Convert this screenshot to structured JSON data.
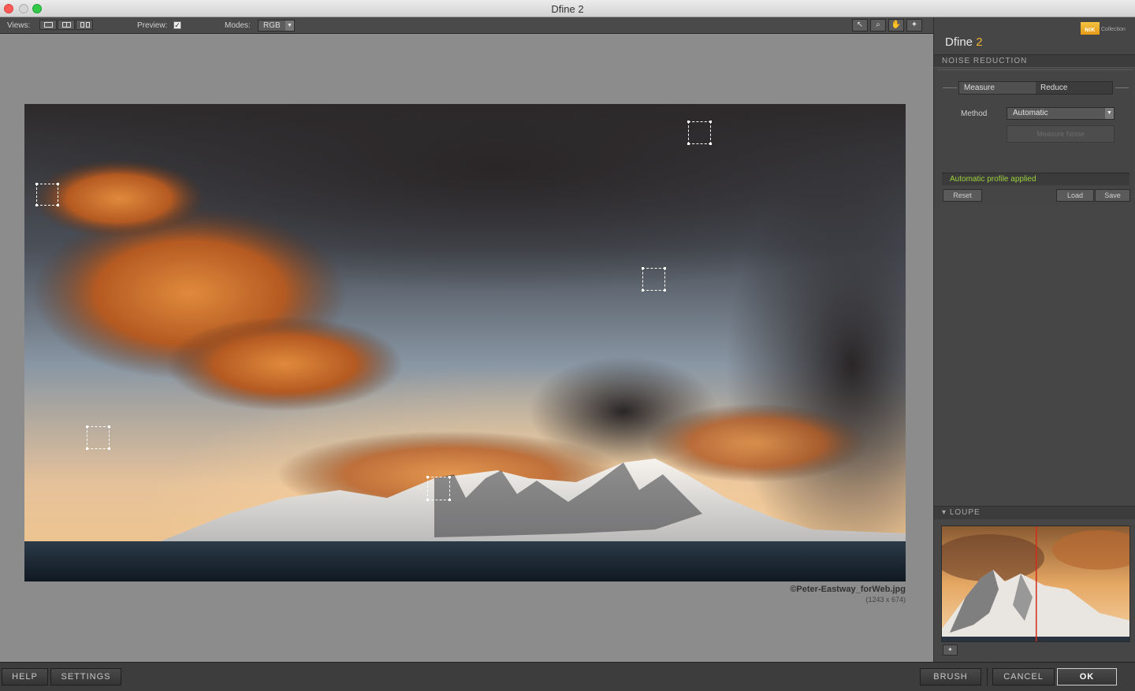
{
  "window": {
    "title": "Dfine 2"
  },
  "toolbar": {
    "views_label": "Views:",
    "preview_label": "Preview:",
    "preview_check": "✓",
    "modes_label": "Modes:",
    "mode_value": "RGB",
    "tools": [
      {
        "name": "pointer-tool-icon",
        "glyph": "↖"
      },
      {
        "name": "zoom-tool-icon",
        "glyph": "⌕"
      },
      {
        "name": "hand-tool-icon",
        "glyph": "✋"
      },
      {
        "name": "add-measure-tool-icon",
        "glyph": "✦"
      }
    ]
  },
  "image": {
    "file_name": "©Peter-Eastway_forWeb.jpg",
    "dimensions": "(1243 x 674)"
  },
  "panel": {
    "brand_mark": "NIK",
    "brand_collection": "Collection",
    "product_name": "Dfine",
    "product_version": "2",
    "section_title": "NOISE REDUCTION",
    "tabs": {
      "measure": "Measure",
      "reduce": "Reduce"
    },
    "method_label": "Method",
    "method_value": "Automatic",
    "measure_noise_button": "Measure Noise",
    "status": "Automatic profile applied",
    "reset_button": "Reset",
    "load_button": "Load",
    "save_button": "Save",
    "loupe_title": "LOUPE",
    "loupe_pin": "✦"
  },
  "bottom": {
    "help": "HELP",
    "settings": "SETTINGS",
    "brush": "BRUSH",
    "cancel": "CANCEL",
    "ok": "OK"
  },
  "colors": {
    "status_green": "#9cd23c",
    "version_gold": "#f0b533",
    "canvas_gray": "#8c8c8c",
    "panel_gray": "#464646"
  }
}
